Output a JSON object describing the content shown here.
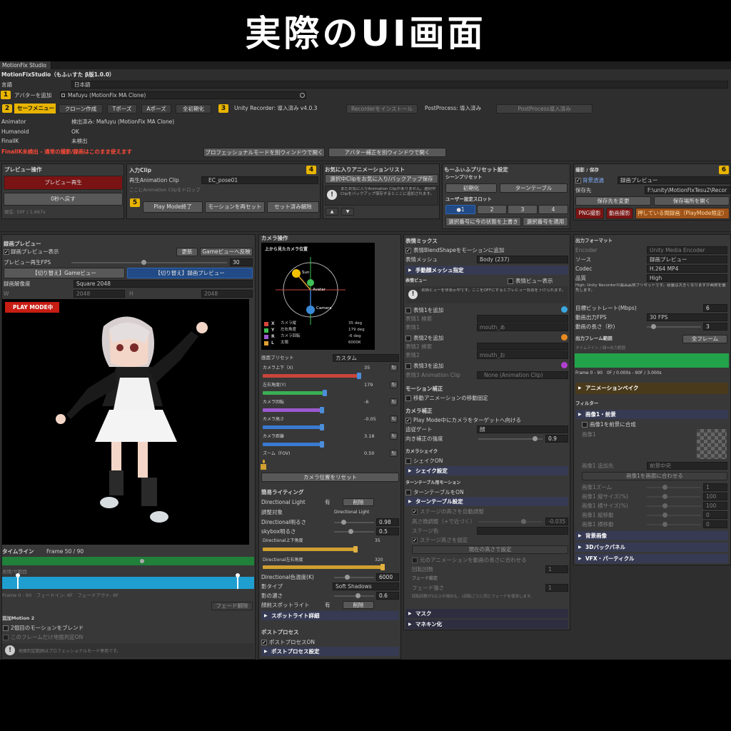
{
  "banner": {
    "title": "実際のUI画面"
  },
  "window": {
    "tab": "MotionFix Studio",
    "title": "MotionFixStudio（もふぃすた β版1.0.0）"
  },
  "top": {
    "lang_label": "言語",
    "lang_value": "日本語",
    "avatar_label": "アバターを追加",
    "avatar_value": "Mafuyu (MotionFix MA Clone)",
    "safe_menu": "セーフメニュー",
    "clone_btn": "クローン作成",
    "tpose_btn": "Tポーズ",
    "apose_btn": "Aポーズ",
    "init_btn": "全初期化",
    "recorder_status": "Unity Recorder: 導入済み v4.0.3",
    "recorder_install": "Recorderをインストール",
    "postprocess_status": "PostProcess: 導入済み",
    "postprocess_install": "PostProcess導入済み",
    "animator_label": "Animator",
    "animator_value": "検出済み: Mafuyu (MotionFix MA Clone)",
    "humanoid_label": "Humanoid",
    "humanoid_value": "OK",
    "finalik_label": "FinalIK",
    "finalik_value": "未検出",
    "finalik_warning": "FinalIK未検出 - 通常の撮影/録画はこのまま使えます",
    "pro_mode_btn": "プロフェッショナルモードを別ウィンドウで開く",
    "avatar_fix_btn": "アバター補正を別ウィンドウで開く"
  },
  "badges": [
    "1",
    "2",
    "3",
    "4",
    "5",
    "6"
  ],
  "preview_ops": {
    "title": "プレビュー操作",
    "play_btn": "プレビュー再生",
    "zero_btn": "0秒へ戻す",
    "status": "現在: 50F / 1.667s"
  },
  "input_clip": {
    "title": "入力Clip",
    "clip_label": "再生Animation Clip",
    "clip_value": "EC_pose01",
    "drop_hint": "ここにAnimation Clipをドロップ",
    "playmode_btn": "Play Mode終了",
    "reset_motion_btn": "モーションを再セット",
    "release_btn": "セット済み解除"
  },
  "favorites": {
    "title": "お気に入りアニメーションリスト",
    "save_btn": "選択中Clipをお気に入り/バックアップ保存",
    "info": "まだお気に入りAnimation Clipがありません。選択中Clipをバックアップ保存するとここに追加されます。",
    "up": "▲",
    "down": "▼"
  },
  "presets": {
    "title": "もーふぃふプリセット設定",
    "scene_label": "シーンプリセット",
    "init_btn": "初期化",
    "turntable_btn": "ターンテーブル",
    "slot_label": "ユーザー設定スロット",
    "slots": [
      "●1",
      "2",
      "3",
      "4"
    ],
    "overwrite_btn": "選択番号に今の状態を上書き",
    "apply_btn": "選択番号を適用"
  },
  "shoot": {
    "title": "撮影 / 保存",
    "bg_label": "背景透過",
    "bg_value": "録画プレビュー",
    "save_label": "保存先",
    "save_value": "F:\\unity\\MotionFixTesu2\\Recor",
    "change_btn": "保存先を変更",
    "open_btn": "保存場所を開く",
    "png_btn": "PNG撮影",
    "video_btn": "動画撮影",
    "hold_btn": "押している間録画（PlayMode限定）"
  },
  "rec_preview": {
    "title": "録画プレビュー",
    "show_label": "録画プレビュー表示",
    "refresh_btn": "更新",
    "reflect_btn": "Gameビューへ反映",
    "fps_label": "プレビュー再生FPS",
    "fps_value": "30",
    "switch_game_btn": "【切り替え】Gameビュー",
    "switch_rec_btn": "【切り替え】録画プレビュー",
    "res_label": "録画解像度",
    "res_value": "Square 2048",
    "w_label": "W",
    "w_value": "2048",
    "h_label": "H",
    "h_value": "2048",
    "playmode_badge": "PLAY MODE中",
    "timeline_label": "タイムライン",
    "frame_label": "Frame 50 / 90",
    "range_label": "表情/サ範囲",
    "range_info": "Frame 0 - 90　フェードイン: 6F　フェードアウト: 6F",
    "fade_btn": "フェード解除"
  },
  "extra": {
    "title": "追加Motion 2",
    "blend_label": "2個目のモーションをブレンド",
    "ground_label": "このフレームだけ地面判定ON",
    "info": "地面判定範囲はプロフェッショナルモード専用です。"
  },
  "camera": {
    "title": "カメラ操作",
    "view_title": "上から見たカメラ位置",
    "legend": [
      {
        "key": "X",
        "label": "カメラ縦",
        "value": "35 deg",
        "color": "#d9453b"
      },
      {
        "key": "Y",
        "label": "左右角度",
        "value": "179 deg",
        "color": "#3fbf55"
      },
      {
        "key": "R",
        "label": "カメラ回転",
        "value": "-6 deg",
        "color": "#9b59d0"
      },
      {
        "key": "L",
        "label": "太陽",
        "value": "6000K",
        "color": "#e0a030"
      }
    ],
    "sun": "Sun",
    "avatar": "Avatar",
    "cam": "Camera",
    "preset_label": "画面プリセット",
    "preset_value": "カスタム",
    "sliders": [
      {
        "label": "カメラ上下（X)",
        "value": "35",
        "color": "#c9453b",
        "fill": 0.78
      },
      {
        "label": "左右角度(Y)",
        "value": "179",
        "color": "#3aaf55",
        "fill": 0.5
      },
      {
        "label": "カメラ回転",
        "value": "-6",
        "color": "#9b59d0",
        "fill": 0.48
      },
      {
        "label": "カメラ高さ",
        "value": "-0.05",
        "color": "#3a7ad0",
        "fill": 0.48
      },
      {
        "label": "カメラ距離",
        "value": "3.18",
        "color": "#3a7ad0",
        "fill": 0.48
      },
      {
        "label": "ズーム（FOV)",
        "value": "0.50",
        "color": "#d0a030",
        "fill": 0.02
      }
    ],
    "reset_btn": "カメラ位置をリセット"
  },
  "lighting": {
    "title": "簡易ライティング",
    "dl_label": "Directional Light",
    "dl_state": "有",
    "dl_btn": "削除",
    "target_label": "調整対象",
    "target_value": "Directional Light",
    "bright_label": "Directional明るさ",
    "bright_value": "0.98",
    "sky_label": "skybox明るさ",
    "sky_value": "0.5",
    "ud_label": "Directional上下角度",
    "ud_value": "35",
    "lr_label": "Directional左右角度",
    "lr_value": "320",
    "temp_label": "Directional色温度(K)",
    "temp_value": "6000",
    "shadow_label": "影タイプ",
    "shadow_value": "Soft Shadows",
    "density_label": "影の濃さ",
    "density_value": "0.6",
    "spot_label": "顔前スポットライト",
    "spot_state": "有",
    "spot_btn": "削除",
    "spot_detail": "スポットライト詳細"
  },
  "post": {
    "title": "ポストプロセス",
    "on_label": "ポストプロセスON",
    "settings": "ポストプロセス設定"
  },
  "expr": {
    "title": "表情ミックス",
    "blend_label": "表情BlendShapeをモーションに追加",
    "mesh_label": "表情メッシュ",
    "mesh_value": "Body (237)",
    "manual": "手動顔メッシュ指定",
    "preview_label": "表情ビュー",
    "preview_show": "表情ビュー表示",
    "preview_info": "表情ビューを非表示中です。ここをOFFにするとプレビュー負荷を下げられます。",
    "e1_add": "表情1を追加",
    "e1_search": "表情1 検索",
    "e1_label": "表情1",
    "e1_value": "mouth_あ",
    "e2_add": "表情2を追加",
    "e2_search": "表情2 検索",
    "e2_label": "表情2",
    "e2_value": "mouth_お",
    "e3_add": "表情3を追加",
    "e3_clip_label": "表情3 Animation Clip",
    "e3_clip_value": "None (Animation Clip)",
    "motion_fix": "モーション補正",
    "move_label": "移動アニメーションの移動固定",
    "cam_fix": "カメラ補正",
    "cam_fix_label": "Play Mode中にカメラをターゲットへ向ける",
    "target_label": "追従ゲート",
    "target_value": "顔",
    "strength_label": "向き補正の強度",
    "strength_value": "0.9",
    "shake": "カメラシェイク",
    "shake_on": "シェイクON",
    "shake_set": "シェイク設定",
    "turn": "ターンテーブル用モーション",
    "turn_on": "ターンテーブルをON",
    "turn_set": "ターンテーブル設定",
    "stage_h": "ステージの高さを自動調整",
    "height_label": "高さ微調整（+で近づく）",
    "height_value": "-0.035",
    "stage_color": "ステージ色",
    "stage_fix": "ステージ高さを固定",
    "cur_height_btn": "現在の高さで設定",
    "adjust_len": "元のアニメーションを動画の長さに合わせる",
    "rot_label": "回転回数",
    "rot_value": "1",
    "fade": "フェード設定",
    "fade_label": "フェード強さ",
    "fade_value": "1",
    "fade_note": "回転回数が2以上の場合も、1回転ごとに同じフェードを使用します。",
    "mask": "マスク",
    "mannequin": "マネキン化"
  },
  "output": {
    "title": "出力フォーマット",
    "encoder_label": "Encoder",
    "encoder_value": "Unity Media Encoder",
    "source_label": "ソース",
    "source_value": "録画プレビュー",
    "codec_label": "Codec",
    "codec_value": "H.264 MP4",
    "quality_label": "品質",
    "quality_value": "High",
    "quality_info": "High: Unity Recorderの最高品質プリセットです。容量は大きくなりますが画質を優先します。",
    "bitrate_label": "目標ビットレート(Mbps)",
    "bitrate_value": "6",
    "fps_label": "動画出力FPS",
    "fps_value": "30 FPS",
    "len_label": "動画の長さ（秒)",
    "len_value": "3",
    "range_title": "出力フレーム範囲",
    "all_btn": "全フレーム",
    "tl_label": "タイムライン / 緑=出力範囲",
    "frame_info": "Frame 0 - 90　0F / 0.000s - 90F / 3.000s",
    "anim_bake": "アニメーションベイク",
    "filter": "フィルター",
    "img1": "画像1・前景",
    "img1_merge": "画像1を前景に合成",
    "img1_label": "画像1",
    "img1_pos_label": "画像1 追加先",
    "img1_pos_value": "前景中央",
    "fit_btn": "画像1を画面に合わせる",
    "img_rows": [
      {
        "label": "画像1ズーム",
        "value": "1"
      },
      {
        "label": "画像1 縦サイズ(%)",
        "value": "100"
      },
      {
        "label": "画像1 横サイズ(%)",
        "value": "100"
      },
      {
        "label": "画像1 縦移動",
        "value": "0"
      },
      {
        "label": "画像1 横移動",
        "value": "0"
      }
    ],
    "bg_img": "背景画像",
    "backpanel": "3Dバックパネル",
    "vfx": "VFX・パーティクル"
  },
  "colors": {
    "accent_yellow": "#e8b400",
    "record_red": "#7a1313",
    "blue_btn": "#214a86",
    "green_range": "#22a34a",
    "timeline_blue": "#1f9fd0",
    "warning_red": "#ff4a3a"
  }
}
